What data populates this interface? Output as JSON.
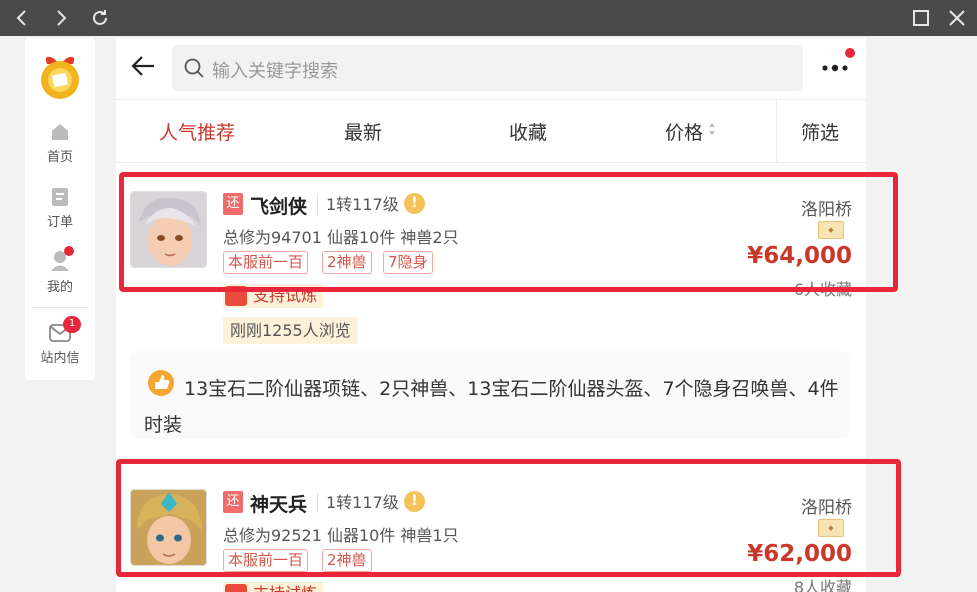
{
  "sidebar": {
    "items": [
      {
        "label": "首页"
      },
      {
        "label": "订单"
      },
      {
        "label": "我的"
      },
      {
        "label": "站内信",
        "badge": "1"
      }
    ]
  },
  "search": {
    "placeholder": "输入关键字搜索"
  },
  "tabs": [
    {
      "label": "人气推荐",
      "active": true
    },
    {
      "label": "最新"
    },
    {
      "label": "收藏"
    },
    {
      "label": "价格"
    },
    {
      "label": "筛选"
    }
  ],
  "listings": [
    {
      "tag": "还",
      "name": "飞剑侠",
      "level": "1转117级",
      "stats": "总修为94701  仙器10件  神兽2只",
      "chips": [
        "本服前一百",
        "2神兽",
        "7隐身"
      ],
      "location": "洛阳桥",
      "price": "¥64,000",
      "favorites": "6人收藏",
      "trial": "支持试炼",
      "views": "刚刚1255人浏览"
    },
    {
      "tag": "还",
      "name": "神天兵",
      "level": "1转117级",
      "stats": "总修为92521  仙器10件  神兽1只",
      "chips": [
        "本服前一百",
        "2神兽"
      ],
      "location": "洛阳桥",
      "price": "¥62,000",
      "favorites": "8人收藏",
      "trial": "支持试炼"
    }
  ],
  "description": "13宝石二阶仙器项链、2只神兽、13宝石二阶仙器头盔、7个隐身召唤兽、4件时装",
  "colors": {
    "accent": "#c8392b",
    "highlight_box": "#e8283a",
    "badge": "#e8283a"
  }
}
